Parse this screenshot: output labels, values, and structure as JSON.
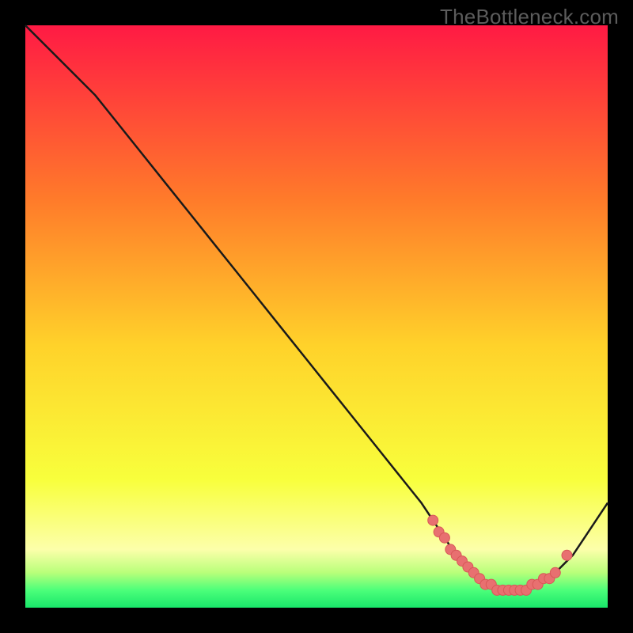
{
  "watermark": "TheBottleneck.com",
  "colors": {
    "background": "#000000",
    "gradient_top": "#ff1a44",
    "gradient_mid_upper": "#ff7b2a",
    "gradient_mid": "#ffd22a",
    "gradient_lower": "#f8ff3c",
    "gradient_pale": "#fcffaa",
    "gradient_green1": "#b8ff7a",
    "gradient_green2": "#4cff7a",
    "gradient_green3": "#18e66a",
    "curve_stroke": "#1a1a1a",
    "marker_fill": "#e87070",
    "marker_stroke": "#d85858"
  },
  "chart_data": {
    "type": "line",
    "title": "",
    "xlabel": "",
    "ylabel": "",
    "xlim": [
      0,
      100
    ],
    "ylim": [
      0,
      100
    ],
    "series": [
      {
        "name": "bottleneck-curve",
        "x": [
          0,
          4,
          8,
          12,
          16,
          20,
          24,
          28,
          32,
          36,
          40,
          44,
          48,
          52,
          56,
          60,
          64,
          68,
          70,
          72,
          74,
          76,
          78,
          80,
          82,
          84,
          86,
          88,
          90,
          92,
          94,
          96,
          98,
          100
        ],
        "y": [
          100,
          96,
          92,
          88,
          83,
          78,
          73,
          68,
          63,
          58,
          53,
          48,
          43,
          38,
          33,
          28,
          23,
          18,
          15,
          12,
          9,
          7,
          5,
          4,
          3,
          3,
          3,
          4,
          5,
          7,
          9,
          12,
          15,
          18
        ]
      }
    ],
    "markers": {
      "name": "optimal-range-dots",
      "x": [
        70,
        71,
        72,
        73,
        74,
        75,
        76,
        77,
        78,
        79,
        80,
        81,
        82,
        83,
        84,
        85,
        86,
        87,
        88,
        89,
        90,
        91,
        93
      ],
      "y": [
        15,
        13,
        12,
        10,
        9,
        8,
        7,
        6,
        5,
        4,
        4,
        3,
        3,
        3,
        3,
        3,
        3,
        4,
        4,
        5,
        5,
        6,
        9
      ]
    }
  }
}
